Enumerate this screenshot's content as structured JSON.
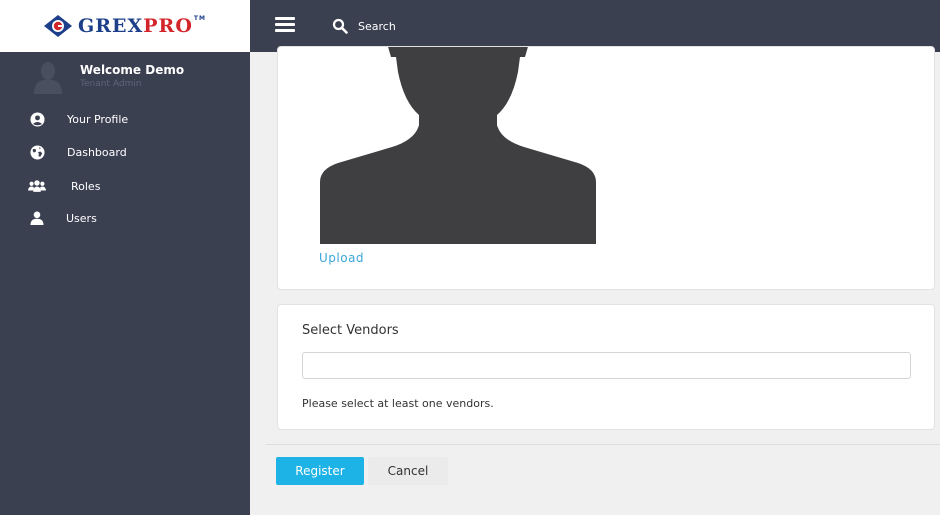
{
  "brand": {
    "part1": "GREX",
    "part2": "PRO",
    "tm": "TM",
    "primary_color": "#1d3f8a",
    "accent_color": "#d3242a"
  },
  "sidebar": {
    "user": {
      "welcome": "Welcome Demo",
      "role": "Tenant Admin"
    },
    "items": [
      {
        "label": "Your Profile",
        "icon": "user-circle-icon"
      },
      {
        "label": "Dashboard",
        "icon": "globe-icon"
      },
      {
        "label": "Roles",
        "icon": "users-group-icon"
      },
      {
        "label": "Users",
        "icon": "user-icon"
      }
    ],
    "bg_color": "#3b4051"
  },
  "topbar": {
    "search_placeholder": "Search"
  },
  "profile": {
    "upload_label": "Upload"
  },
  "vendors": {
    "title": "Select Vendors",
    "value": "",
    "message": "Please select at least one vendors."
  },
  "actions": {
    "register_label": "Register",
    "cancel_label": "Cancel",
    "register_color": "#1db3e6"
  }
}
